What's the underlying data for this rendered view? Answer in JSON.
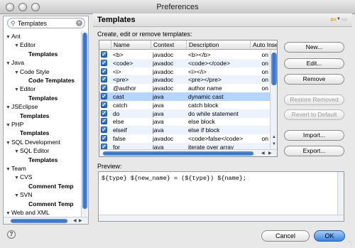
{
  "window": {
    "title": "Preferences"
  },
  "sidebar": {
    "filter_value": "Templates",
    "items": [
      {
        "label": "Ant",
        "expanded": true,
        "bold": false
      },
      {
        "label": "Editor",
        "expanded": true,
        "bold": false
      },
      {
        "label": "Templates",
        "expanded": null,
        "bold": true
      },
      {
        "label": "Java",
        "expanded": true,
        "bold": false
      },
      {
        "label": "Code Style",
        "expanded": true,
        "bold": false
      },
      {
        "label": "Code Templates",
        "expanded": null,
        "bold": true
      },
      {
        "label": "Editor",
        "expanded": true,
        "bold": false
      },
      {
        "label": "Templates",
        "expanded": null,
        "bold": true
      },
      {
        "label": "JSEclipse",
        "expanded": true,
        "bold": false
      },
      {
        "label": "Templates",
        "expanded": null,
        "bold": true
      },
      {
        "label": "PHP",
        "expanded": true,
        "bold": false
      },
      {
        "label": "Templates",
        "expanded": null,
        "bold": true
      },
      {
        "label": "SQL Development",
        "expanded": true,
        "bold": false
      },
      {
        "label": "SQL Editor",
        "expanded": true,
        "bold": false
      },
      {
        "label": "Templates",
        "expanded": null,
        "bold": true
      },
      {
        "label": "Team",
        "expanded": true,
        "bold": false
      },
      {
        "label": "CVS",
        "expanded": true,
        "bold": false
      },
      {
        "label": "Comment Temp",
        "expanded": null,
        "bold": true
      },
      {
        "label": "SVN",
        "expanded": true,
        "bold": false
      },
      {
        "label": "Comment Temp",
        "expanded": null,
        "bold": true
      },
      {
        "label": "Web and XML",
        "expanded": true,
        "bold": false
      }
    ]
  },
  "header": {
    "title": "Templates"
  },
  "main": {
    "subtitle": "Create, edit or remove templates:",
    "columns": [
      "Name",
      "Context",
      "Description",
      "Auto Inser"
    ],
    "rows": [
      {
        "name": "<b>",
        "context": "javadoc",
        "description": "<b></b>",
        "auto": "on"
      },
      {
        "name": "<code>",
        "context": "javadoc",
        "description": "<code></code>",
        "auto": "on"
      },
      {
        "name": "<i>",
        "context": "javadoc",
        "description": "<i></i>",
        "auto": "on"
      },
      {
        "name": "<pre>",
        "context": "javadoc",
        "description": "<pre></pre>",
        "auto": "on"
      },
      {
        "name": "@author",
        "context": "javadoc",
        "description": "author name",
        "auto": "on"
      },
      {
        "name": "cast",
        "context": "java",
        "description": "dynamic cast",
        "auto": ""
      },
      {
        "name": "catch",
        "context": "java",
        "description": "catch block",
        "auto": ""
      },
      {
        "name": "do",
        "context": "java",
        "description": "do while statement",
        "auto": ""
      },
      {
        "name": "else",
        "context": "java",
        "description": "else block",
        "auto": ""
      },
      {
        "name": "elseif",
        "context": "java",
        "description": "else if block",
        "auto": ""
      },
      {
        "name": "false",
        "context": "javadoc",
        "description": "<code>false</code>",
        "auto": "on"
      },
      {
        "name": "for",
        "context": "java",
        "description": "iterate over array",
        "auto": ""
      }
    ],
    "selected_row": 5,
    "buttons": {
      "new": "New...",
      "edit": "Edit...",
      "remove": "Remove",
      "restore": "Restore Removed",
      "revert": "Revert to Default",
      "import": "Import...",
      "export": "Export..."
    },
    "preview_label": "Preview:",
    "preview_text": "${type} ${new_name} = (${type}) ${name};"
  },
  "footer": {
    "cancel": "Cancel",
    "ok": "OK",
    "help_glyph": "?"
  },
  "icons": {
    "search": "search-icon",
    "clear": "clear-icon",
    "back": "back-arrow-icon",
    "forward": "forward-arrow-icon",
    "help": "help-icon"
  },
  "colors": {
    "selection": "#b5d5ff",
    "alt_row": "#edf3fe",
    "ok_button": "#3b84df"
  }
}
